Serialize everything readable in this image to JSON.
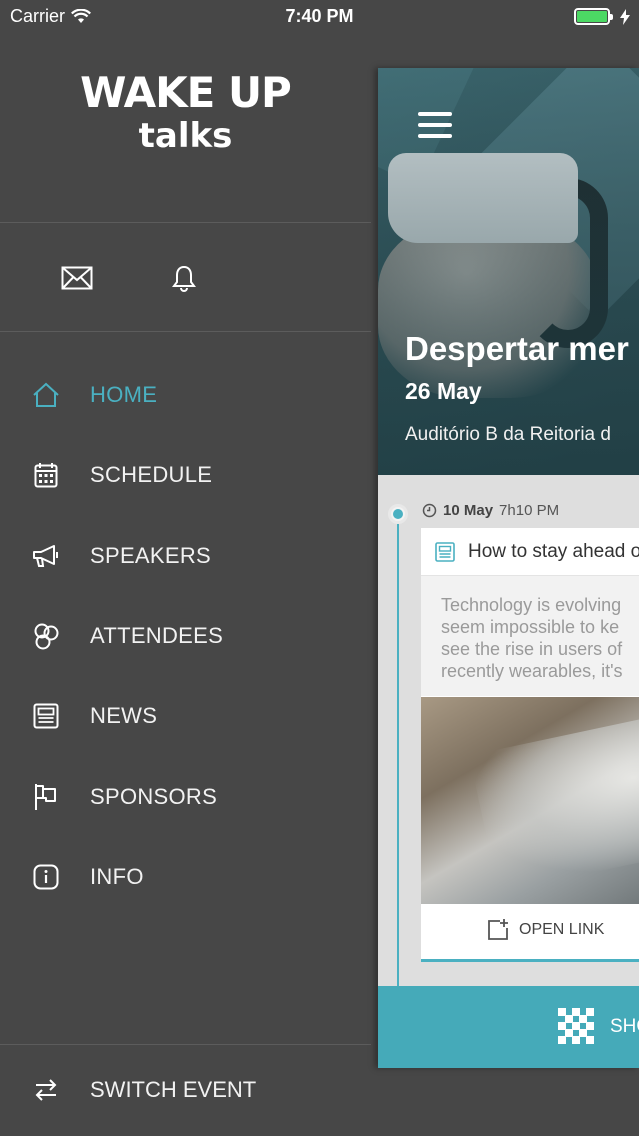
{
  "status_bar": {
    "carrier": "Carrier",
    "time": "7:40 PM"
  },
  "drawer": {
    "logo": {
      "line1": "WAKE UP",
      "line2": "talks"
    },
    "icons": [
      {
        "name": "mail-icon"
      },
      {
        "name": "bell-icon"
      }
    ],
    "menu": [
      {
        "label": "HOME",
        "icon": "home-icon",
        "active": true
      },
      {
        "label": "SCHEDULE",
        "icon": "calendar-icon",
        "active": false
      },
      {
        "label": "SPEAKERS",
        "icon": "megaphone-icon",
        "active": false
      },
      {
        "label": "ATTENDEES",
        "icon": "attendees-icon",
        "active": false
      },
      {
        "label": "NEWS",
        "icon": "news-icon",
        "active": false
      },
      {
        "label": "SPONSORS",
        "icon": "flag-icon",
        "active": false
      },
      {
        "label": "INFO",
        "icon": "info-icon",
        "active": false
      }
    ],
    "switch_event": "SWITCH EVENT"
  },
  "content": {
    "hero": {
      "title": "Despertar mer",
      "date": "26 May",
      "venue": "Auditório B da Reitoria d"
    },
    "post": {
      "date": "10 May",
      "time": "7h10 PM",
      "title": "How to stay ahead o",
      "excerpt": [
        "Technology is evolving",
        "seem impossible to ke",
        "see the rise in users of",
        "recently wearables, it's"
      ],
      "open_link": "OPEN LINK"
    },
    "bottom_bar": {
      "label": "SHO"
    }
  },
  "colors": {
    "accent": "#4ab0c1",
    "drawer_bg": "#474747",
    "bottom_bar": "#45aab9",
    "battery": "#4cd964"
  }
}
